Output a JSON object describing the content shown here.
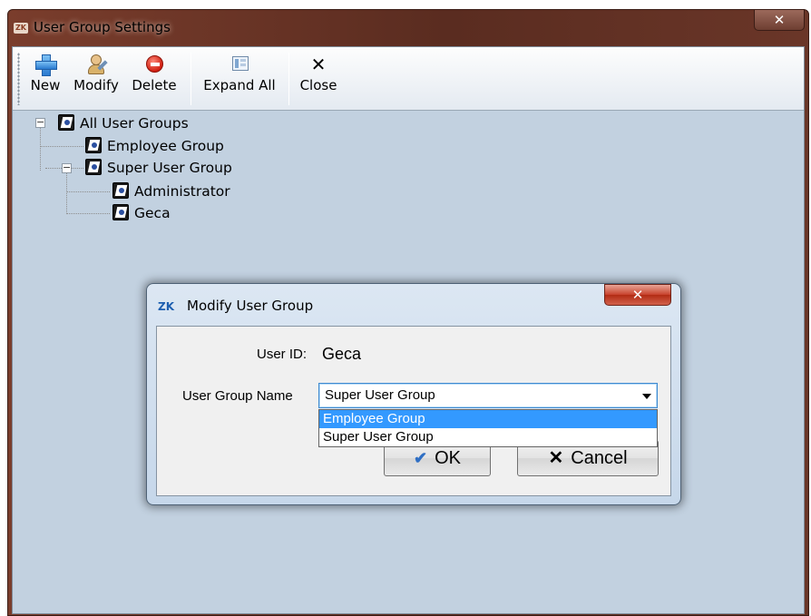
{
  "window": {
    "title": "User Group Settings",
    "icon_label": "ZK",
    "close_glyph": "✕"
  },
  "toolbar": {
    "buttons": [
      {
        "label": "New",
        "icon": "plus-icon"
      },
      {
        "label": "Modify",
        "icon": "user-edit-icon"
      },
      {
        "label": "Delete",
        "icon": "delete-icon"
      },
      {
        "label": "Expand All",
        "icon": "expand-all-icon"
      },
      {
        "label": "Close",
        "icon": "close-icon"
      }
    ],
    "close_glyph": "✕"
  },
  "tree": {
    "root": {
      "label": "All User Groups",
      "expander": "−"
    },
    "employee_group": {
      "label": "Employee Group"
    },
    "super_user_group": {
      "label": "Super User Group",
      "expander": "−"
    },
    "administrator": {
      "label": "Administrator"
    },
    "geca": {
      "label": "Geca"
    }
  },
  "dialog": {
    "title": "Modify User Group",
    "icon_label": "ZK",
    "close_glyph": "✕",
    "user_id_label": "User ID:",
    "user_id_value": "Geca",
    "group_name_label": "User Group Name",
    "group_name_selected": "Super User Group",
    "options": [
      "Employee Group",
      "Super User Group"
    ],
    "highlighted_option": "Employee Group",
    "ok_label": "OK",
    "ok_glyph": "✔",
    "cancel_label": "Cancel",
    "cancel_glyph": "✕"
  },
  "colors": {
    "client_background": "#c2d1e0",
    "selection_highlight": "#3399ff",
    "window_frame": "#5a2c20"
  }
}
